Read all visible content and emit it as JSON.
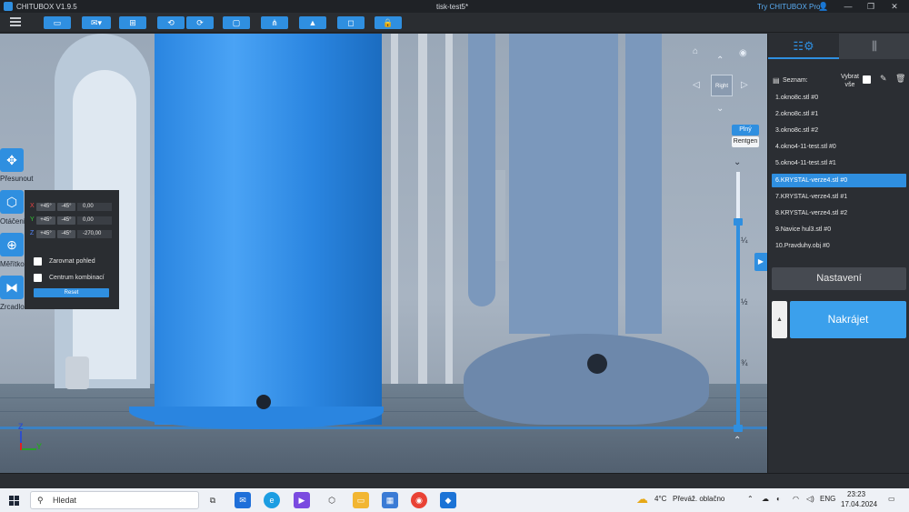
{
  "window": {
    "app_name": "CHITUBOX V1.9.5",
    "document": "tisk-test5*",
    "try_pro": "Try CHITUBOX Pro"
  },
  "toolbar": {
    "buttons": [
      "open-folder-icon",
      "save-icon",
      "auto-layout-icon",
      "undo-icon",
      "redo-icon",
      "screenshot-icon",
      "network-icon",
      "support-icon",
      "hollow-icon",
      "lock-icon"
    ]
  },
  "view": {
    "cube_label": "Right",
    "mode_plny": "Plný",
    "mode_rentgen": "Rentgen",
    "slider_marks": [
      "¼",
      "½",
      "¾"
    ],
    "layer_fraction": 0.8
  },
  "tools": {
    "move": "Přesunout",
    "rotate": "Otáčení",
    "scale": "Měřítko",
    "mirror": "Zrcadlo"
  },
  "rotate_panel": {
    "rows": [
      {
        "axis": "X",
        "plus": "+45°",
        "minus": "-45°",
        "value": "0,00"
      },
      {
        "axis": "Y",
        "plus": "+45°",
        "minus": "-45°",
        "value": "0,00"
      },
      {
        "axis": "Z",
        "plus": "+45°",
        "minus": "-45°",
        "value": "-270,00"
      }
    ],
    "align_view": "Zarovnat pohled",
    "center_combo": "Centrum kombinací",
    "reset": "Reset"
  },
  "axis_indicator": {
    "z": "Z",
    "y": "Y"
  },
  "right_panel": {
    "list_title": "Seznam:",
    "select_all": "Vybrat vše",
    "items": [
      "1.okno8c.stl #0",
      "2.okno8c.stl #1",
      "3.okno8c.stl #2",
      "4.okno4-11-test.stl #0",
      "5.okno4-11-test.stl #1",
      "6.KRYSTAL-verze4.stl #0",
      "7.KRYSTAL-verze4.stl #1",
      "8.KRYSTAL-verze4.stl #2",
      "9.Navice hul3.stl #0",
      "10.Pravduhy.obj #0"
    ],
    "selected_index": 5,
    "settings": "Nastavení",
    "slice": "Nakrájet"
  },
  "taskbar": {
    "search_placeholder": "Hledat",
    "weather_temp": "4°C",
    "weather_text": "Převáž. oblačno",
    "lang": "ENG",
    "time": "23:23",
    "date": "17.04.2024"
  },
  "colors": {
    "accent": "#2f8fe0",
    "model_blue": "#2a85e0",
    "model_grey": "#7b98bc",
    "panel": "#2b2e33"
  }
}
